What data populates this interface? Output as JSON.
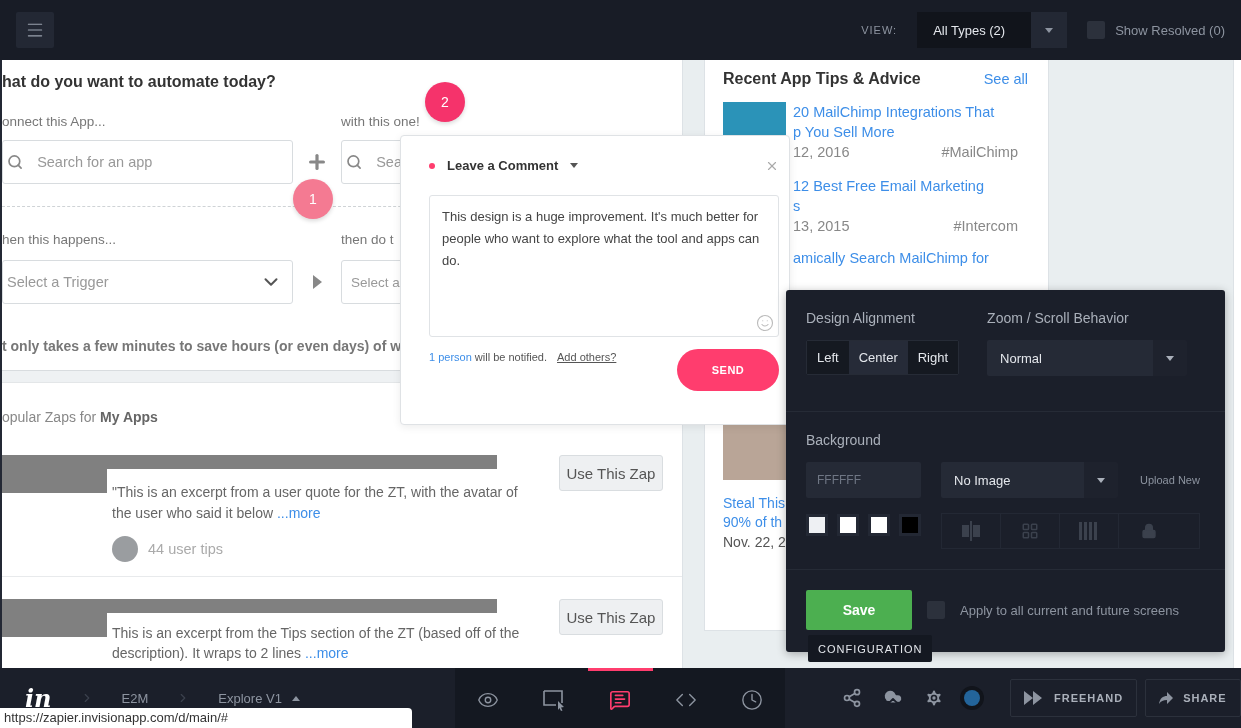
{
  "top_bar": {
    "view_label": "VIEW:",
    "view_select": "All Types (2)",
    "show_resolved": {
      "label": "Show Resolved (0)",
      "checked": false
    }
  },
  "automate": {
    "title": "hat do you want to automate today?",
    "connect_label": "onnect this App...",
    "with_label": "with this one!",
    "search_placeholder": "Search for an app",
    "search2_placeholder": "Sea",
    "when_label": "hen this happens...",
    "then_label": "then do t",
    "trigger_placeholder": "Select a Trigger",
    "action_placeholder": "Select a",
    "footer": "t only takes a few minutes to save hours (or even days) of w"
  },
  "popular": {
    "heading": "opular Zaps for **My Apps**",
    "zaps": [
      {
        "excerpt": "\"This is an excerpt from a user quote for the ZT, with the avatar of the user who said it below",
        "more": "...more",
        "tips": "44 user tips",
        "button": "Use This Zap"
      },
      {
        "excerpt": "This is an excerpt from the Tips section of the ZT (based off of the description). It wraps to 2 lines",
        "more": "...more",
        "button": "Use This Zap"
      }
    ]
  },
  "tips": {
    "title": "Recent App Tips & Advice",
    "see_all": "See all",
    "items": [
      {
        "thumb": true,
        "lines": [
          "20 MailChimp Integrations That",
          "p You Sell More"
        ],
        "date": "12, 2016",
        "tag": "#MailChimp"
      },
      {
        "thumb": false,
        "lines": [
          "12 Best Free Email Marketing",
          "s"
        ],
        "date": "13, 2015",
        "tag": "#Intercom"
      },
      {
        "thumb": false,
        "lines": [
          "amically Search MailChimp for"
        ]
      }
    ],
    "photo_tip": {
      "lines": [
        "Steal This",
        "90% of th"
      ],
      "date": "Nov. 22, 2"
    }
  },
  "pins": [
    {
      "label": "1"
    },
    {
      "label": "2"
    }
  ],
  "comment": {
    "title": "Leave a Comment",
    "text": "This design is a huge improvement. It's much better for people who want to explore what the tool and apps can do.",
    "notify_link": "1 person",
    "notify_rest": " will be notified.",
    "add_others": "Add others?",
    "send": "SEND"
  },
  "config": {
    "alignment_label": "Design Alignment",
    "alignments": [
      {
        "label": "Left",
        "selected": false
      },
      {
        "label": "Center",
        "selected": true
      },
      {
        "label": "Right",
        "selected": false
      }
    ],
    "zoom_label": "Zoom / Scroll Behavior",
    "zoom_value": "Normal",
    "background_label": "Background",
    "hex_placeholder": "FFFFFF",
    "image_value": "No Image",
    "upload": "Upload New",
    "swatches": [
      {
        "color": "#eef0f3"
      },
      {
        "color": "#ffffff"
      },
      {
        "color": "#ffffff"
      },
      {
        "color": "#000000"
      }
    ],
    "save": "Save",
    "apply": {
      "label": "Apply to all current and future screens",
      "checked": false
    }
  },
  "tooltip": "CONFIGURATION",
  "bottom_bar": {
    "logo": "in",
    "crumbs": [
      "E2M",
      "Explore V1"
    ],
    "tools": [
      {
        "kind": "preview",
        "selected": false
      },
      {
        "kind": "build",
        "selected": false
      },
      {
        "kind": "comment",
        "selected": true
      },
      {
        "kind": "inspect",
        "selected": false
      },
      {
        "kind": "history",
        "selected": false
      }
    ],
    "freehand": "FREEHAND",
    "share": "SHARE"
  },
  "status_url": "https://zapier.invisionapp.com/d/main/#"
}
